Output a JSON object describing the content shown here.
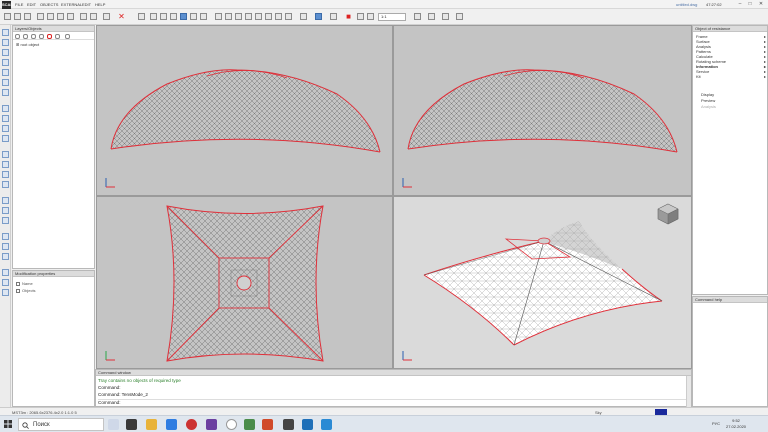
{
  "app": {
    "logo": "SCAD",
    "menu": [
      "FILE",
      "EDIT",
      "OBJECTS",
      "EXTERNAL",
      "EDIT",
      "HELP"
    ],
    "window_title": "untitled.dwg",
    "window_time": "47:27:02"
  },
  "toolbar": {
    "zoom_value": "1:1"
  },
  "layers_panel": {
    "title": "Layers/Objects",
    "row_label": "root object"
  },
  "props_panel": {
    "title": "Modification properties",
    "rows": [
      "Name",
      "Objects"
    ]
  },
  "right_panel": {
    "title": "Object of resistance",
    "items": [
      {
        "label": "Frame",
        "arrow": "▸"
      },
      {
        "label": "Surface",
        "arrow": "▸"
      },
      {
        "label": "Analysis",
        "arrow": "▸"
      },
      {
        "label": "Patterns",
        "arrow": "▸"
      },
      {
        "label": "Calculate",
        "arrow": "▸"
      },
      {
        "label": "Rotating scheme",
        "arrow": "▸"
      },
      {
        "label": "Information",
        "arrow": "▸"
      },
      {
        "label": "Service",
        "arrow": "▸"
      },
      {
        "label": "Kit",
        "arrow": "▸"
      }
    ],
    "sub_items": [
      "Display",
      "Preview",
      "Analysis"
    ]
  },
  "command_help": {
    "title": "Command help"
  },
  "command_window": {
    "title": "Command window",
    "lines": [
      {
        "text": "Tray contains no objects of required type",
        "color": "#2a7f2a"
      },
      {
        "text": "Command:",
        "color": "#222222"
      },
      {
        "text": "Command: TensMode_2",
        "color": "#222222"
      },
      {
        "text": "Command:",
        "color": "#222222"
      }
    ]
  },
  "statusbar": {
    "left_text": "MST3m : 2065.6x2376.4x2.0 1:1.0 5",
    "snap_label": "Sky"
  },
  "taskbar": {
    "search_label": "Поиск",
    "lang": "РУС",
    "time": "9:52",
    "date": "27.02.2020"
  },
  "colors": {
    "edge_red": "#e0303a",
    "mesh_gray": "#5a5a5a",
    "accent_blue": "#2b5fb0"
  }
}
